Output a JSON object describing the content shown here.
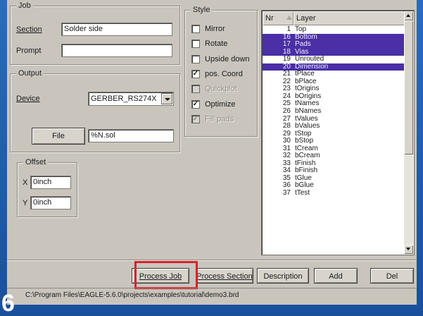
{
  "job": {
    "title": "Job",
    "section_label": "Section",
    "section_value": "Solder side",
    "prompt_label": "Prompt",
    "prompt_value": ""
  },
  "output": {
    "title": "Output",
    "device_label": "Device",
    "device_value": "GERBER_RS274X",
    "file_button": "File",
    "file_value": "%N.sol"
  },
  "offset": {
    "title": "Offset",
    "x_label": "X",
    "x_value": "0inch",
    "y_label": "Y",
    "y_value": "0inch"
  },
  "style": {
    "title": "Style",
    "options": [
      {
        "label": "Mirror",
        "checked": false,
        "enabled": true
      },
      {
        "label": "Rotate",
        "checked": false,
        "enabled": true
      },
      {
        "label": "Upside down",
        "checked": false,
        "enabled": true
      },
      {
        "label": "pos. Coord",
        "checked": true,
        "enabled": true
      },
      {
        "label": "Quickplot",
        "checked": false,
        "enabled": false
      },
      {
        "label": "Optimize",
        "checked": true,
        "enabled": true
      },
      {
        "label": "Fill pads",
        "checked": true,
        "enabled": false
      }
    ]
  },
  "layers": {
    "col_nr": "Nr",
    "col_layer": "Layer",
    "rows": [
      {
        "nr": "1",
        "name": "Top",
        "selected": false
      },
      {
        "nr": "16",
        "name": "Bottom",
        "selected": true
      },
      {
        "nr": "17",
        "name": "Pads",
        "selected": true
      },
      {
        "nr": "18",
        "name": "Vias",
        "selected": true
      },
      {
        "nr": "19",
        "name": "Unrouted",
        "selected": false
      },
      {
        "nr": "20",
        "name": "Dimension",
        "selected": true
      },
      {
        "nr": "21",
        "name": "tPlace",
        "selected": false
      },
      {
        "nr": "22",
        "name": "bPlace",
        "selected": false
      },
      {
        "nr": "23",
        "name": "tOrigins",
        "selected": false
      },
      {
        "nr": "24",
        "name": "bOrigins",
        "selected": false
      },
      {
        "nr": "25",
        "name": "tNames",
        "selected": false
      },
      {
        "nr": "26",
        "name": "bNames",
        "selected": false
      },
      {
        "nr": "27",
        "name": "tValues",
        "selected": false
      },
      {
        "nr": "28",
        "name": "bValues",
        "selected": false
      },
      {
        "nr": "29",
        "name": "tStop",
        "selected": false
      },
      {
        "nr": "30",
        "name": "bStop",
        "selected": false
      },
      {
        "nr": "31",
        "name": "tCream",
        "selected": false
      },
      {
        "nr": "32",
        "name": "bCream",
        "selected": false
      },
      {
        "nr": "33",
        "name": "tFinish",
        "selected": false
      },
      {
        "nr": "34",
        "name": "bFinish",
        "selected": false
      },
      {
        "nr": "35",
        "name": "tGlue",
        "selected": false
      },
      {
        "nr": "36",
        "name": "bGlue",
        "selected": false
      },
      {
        "nr": "37",
        "name": "tTest",
        "selected": false
      }
    ]
  },
  "buttons": {
    "process_job": "Process Job",
    "process_section": "Process Section",
    "description": "Description",
    "add": "Add",
    "del": "Del"
  },
  "status": {
    "path": "C:\\Program Files\\EAGLE-5.6.0\\projects\\examples\\tutorial\\demo3.brd"
  },
  "step_number": "6",
  "colors": {
    "dialog_bg": "#c9c5bd",
    "selection": "#4a2fa6",
    "highlight_box": "#d8202a",
    "frame": "#1d56a6"
  }
}
